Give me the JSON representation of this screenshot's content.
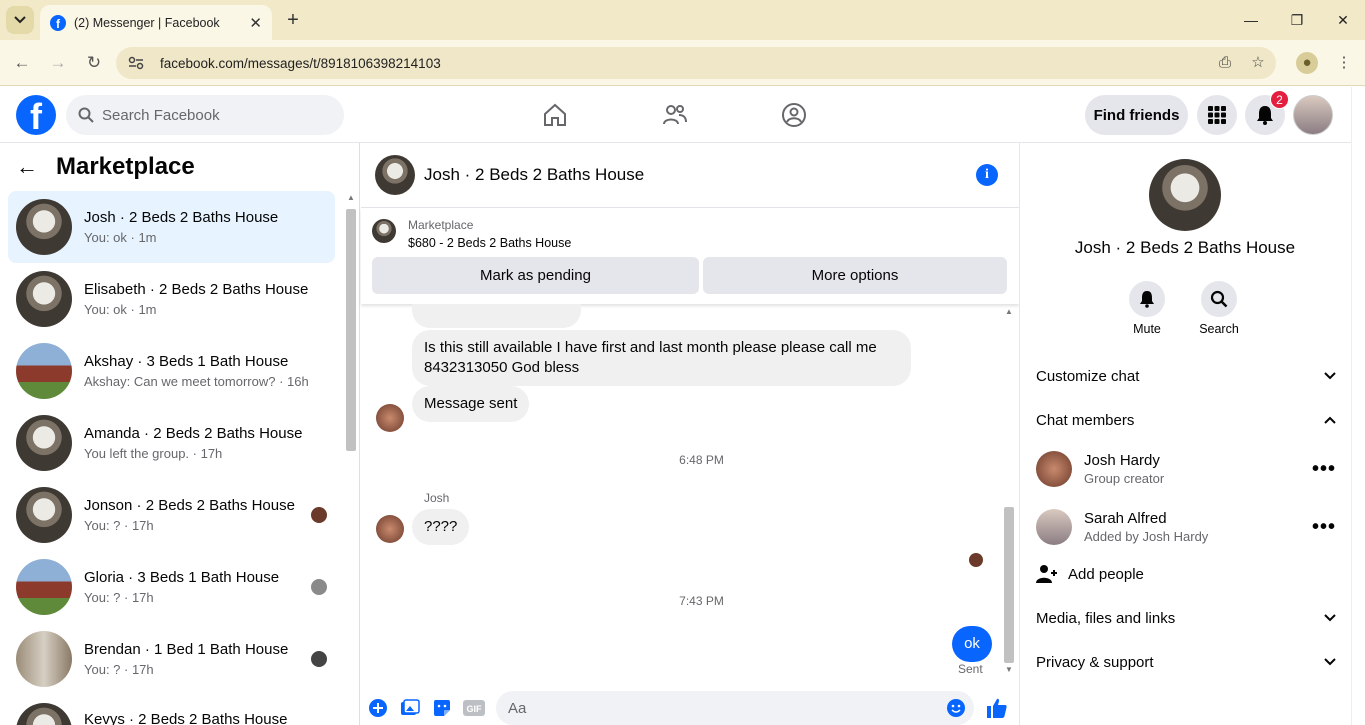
{
  "browser": {
    "tab_title": "(2) Messenger | Facebook",
    "url": "facebook.com/messages/t/8918106398214103"
  },
  "fb": {
    "search_placeholder": "Search Facebook",
    "find_friends": "Find friends",
    "notification_count": "2"
  },
  "left": {
    "title": "Marketplace",
    "conversations": [
      {
        "name": "Josh · 2 Beds 2 Baths House",
        "preview": "You: ok · 1m"
      },
      {
        "name": "Elisabeth · 2 Beds 2 Baths House",
        "preview": "You: ok · 1m"
      },
      {
        "name": "Akshay · 3 Beds 1 Bath House",
        "preview": "Akshay: Can we meet tomorrow? · 16h"
      },
      {
        "name": "Amanda · 2 Beds 2 Baths House",
        "preview": "You left the group. · 17h"
      },
      {
        "name": "Jonson · 2 Beds 2 Baths House",
        "preview": "You: ? · 17h"
      },
      {
        "name": "Gloria · 3 Beds 1 Bath House",
        "preview": "You: ? · 17h"
      },
      {
        "name": "Brendan · 1 Bed 1 Bath House",
        "preview": "You: ? · 17h"
      },
      {
        "name": "Kevys · 2 Beds 2 Baths House",
        "preview": ""
      }
    ]
  },
  "chat": {
    "title": "Josh · 2 Beds 2 Baths House",
    "marketplace_label": "Marketplace",
    "listing": "$680 - 2 Beds 2 Baths House",
    "mark_pending": "Mark as pending",
    "more_options": "More options",
    "messages": {
      "m1": "Is this still available I have first and last month please please call me 8432313050 God bless",
      "m2": "Message sent",
      "time1": "6:48 PM",
      "sender": "Josh",
      "m3": "????",
      "time2": "7:43 PM",
      "m4": "ok",
      "status": "Sent"
    },
    "input_placeholder": "Aa"
  },
  "right": {
    "name": "Josh · 2 Beds 2 Baths House",
    "mute": "Mute",
    "search": "Search",
    "customize_chat": "Customize chat",
    "chat_members": "Chat members",
    "members": [
      {
        "name": "Josh Hardy",
        "sub": "Group creator"
      },
      {
        "name": "Sarah Alfred",
        "sub": "Added by Josh Hardy"
      }
    ],
    "add_people": "Add people",
    "media": "Media, files and links",
    "privacy": "Privacy & support"
  },
  "colors": {
    "accent": "#0866ff",
    "active_row": "#e7f3ff",
    "badge": "#e41e3f"
  }
}
